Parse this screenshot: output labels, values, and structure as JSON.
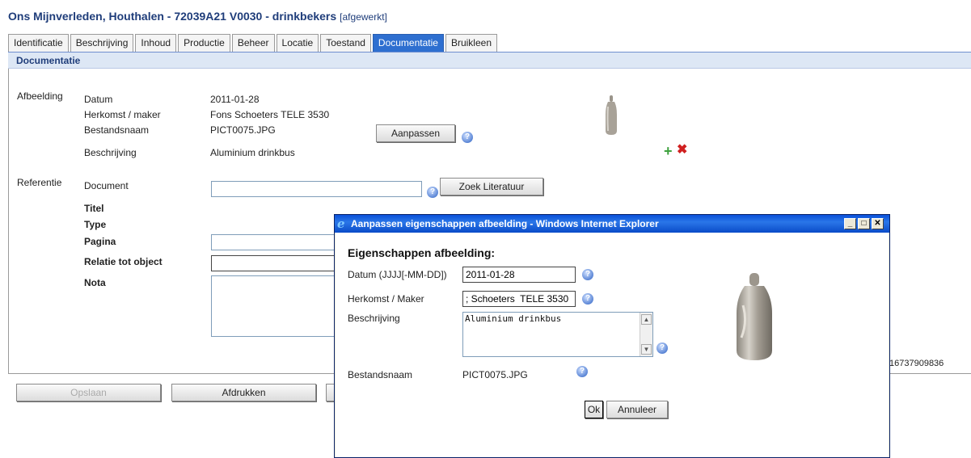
{
  "header": {
    "title": "Ons Mijnverleden, Houthalen - 72039A21 V0030 - drinkbekers",
    "status": "[afgewerkt]"
  },
  "tabs": [
    {
      "label": "Identificatie",
      "active": false
    },
    {
      "label": "Beschrijving",
      "active": false
    },
    {
      "label": "Inhoud",
      "active": false
    },
    {
      "label": "Productie",
      "active": false
    },
    {
      "label": "Beheer",
      "active": false
    },
    {
      "label": "Locatie",
      "active": false
    },
    {
      "label": "Toestand",
      "active": false
    },
    {
      "label": "Documentatie",
      "active": true
    },
    {
      "label": "Bruikleen",
      "active": false
    }
  ],
  "section": {
    "title": "Documentatie"
  },
  "afbeelding": {
    "section_label": "Afbeelding",
    "datum_label": "Datum",
    "datum_value": "2011-01-28",
    "herkomst_label": "Herkomst / maker",
    "herkomst_value": "Fons Schoeters  TELE 3530",
    "bestandsnaam_label": "Bestandsnaam",
    "bestandsnaam_value": "PICT0075.JPG",
    "aanpassen_button": "Aanpassen",
    "beschrijving_label": "Beschrijving",
    "beschrijving_value": "Aluminium drinkbus",
    "add_icon": "+",
    "delete_icon": "✖"
  },
  "referentie": {
    "section_label": "Referentie",
    "document_label": "Document",
    "document_value": "",
    "zoek_button": "Zoek Literatuur",
    "titel_label": "Titel",
    "type_label": "Type",
    "pagina_label": "Pagina",
    "relatie_label": "Relatie tot object",
    "nota_label": "Nota"
  },
  "right_number": "16737909836",
  "bottom_buttons": {
    "opslaan": "Opslaan",
    "afdrukken": "Afdrukken"
  },
  "dialog": {
    "window_title": "Aanpassen eigenschappen afbeelding - Windows Internet Explorer",
    "heading": "Eigenschappen afbeelding:",
    "datum_label": "Datum (JJJJ[-MM-DD])",
    "datum_value": "2011-01-28",
    "herkomst_label": "Herkomst / Maker",
    "herkomst_value": "; Schoeters  TELE 3530",
    "beschrijving_label": "Beschrijving",
    "beschrijving_value": "Aluminium drinkbus",
    "bestandsnaam_label": "Bestandsnaam",
    "bestandsnaam_value": "PICT0075.JPG",
    "ok_button": "Ok",
    "annuleer_button": "Annuleer",
    "minimize": "_",
    "maximize": "□",
    "close": "✕"
  },
  "colors": {
    "title_blue": "#1f3d7a",
    "active_tab": "#2e6fd0",
    "section_bar": "#dde7f5",
    "xp_titlebar": "#0a50d8"
  }
}
